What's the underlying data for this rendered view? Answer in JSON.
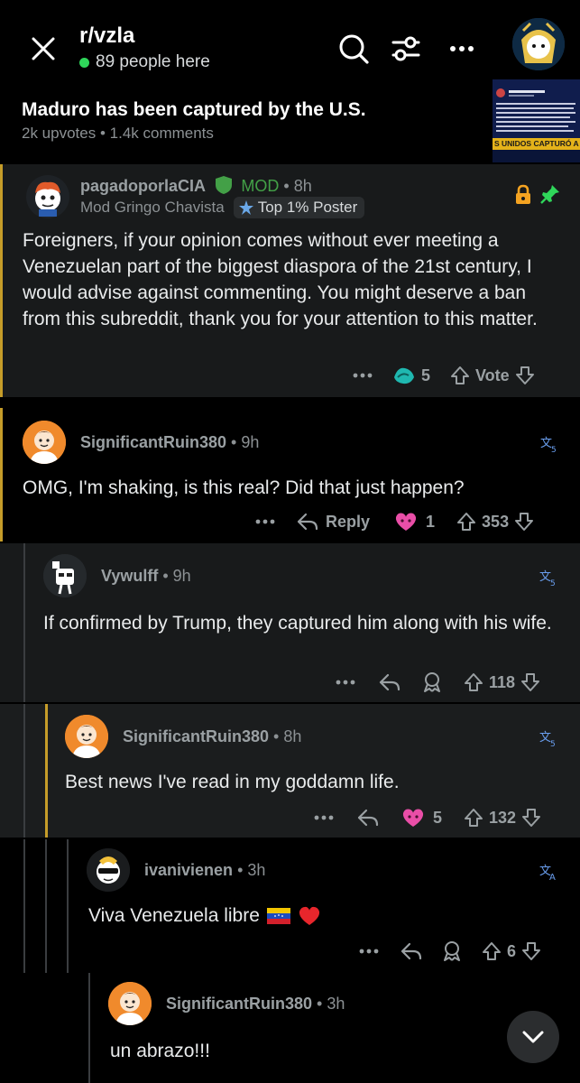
{
  "header": {
    "subreddit": "r/vzla",
    "online": "89 people here"
  },
  "post": {
    "title": "Maduro has been captured by the U.S.",
    "upvotes": "2k upvotes",
    "comments": "1.4k comments",
    "thumb_banner": "S UNIDOS CAPTURÓ A MADU"
  },
  "comments": [
    {
      "user": "pagadoporlaCIA",
      "badge": "MOD",
      "time": "• 8h",
      "user_flair": "Mod Gringo Chavista",
      "achievement": "Top 1% Poster",
      "body": "Foreigners, if your opinion comes without ever meeting a Venezuelan part of the biggest diaspora of the 21st century, I would advise against commenting. You might deserve a ban from this subreddit, thank you for your attention to this matter.",
      "award_count": "5",
      "vote": "Vote"
    },
    {
      "user": "SignificantRuin380",
      "time": "• 9h",
      "body": "OMG, I'm shaking, is this real? Did that just happen?",
      "reply": "Reply",
      "award_count": "1",
      "vote": "353"
    },
    {
      "user": "Vywulff",
      "time": "• 9h",
      "body": "If confirmed by Trump, they captured him along with his wife.",
      "vote": "118"
    },
    {
      "user": "SignificantRuin380",
      "time": "• 8h",
      "body": "Best news I've read in my goddamn life.",
      "award_count": "5",
      "vote": "132"
    },
    {
      "user": "ivanivienen",
      "time": "• 3h",
      "body": "Viva Venezuela libre",
      "vote": "6"
    },
    {
      "user": "SignificantRuin380",
      "time": "• 3h",
      "body": "un abrazo!!!"
    }
  ],
  "colors": {
    "gold_bar": "#c59c29",
    "mod_green": "#43a047",
    "online_dot": "#2fd65a",
    "award_pink": "#e94ea7"
  }
}
